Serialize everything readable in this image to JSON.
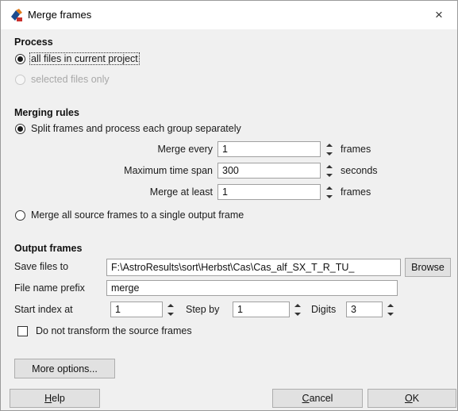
{
  "window": {
    "title": "Merge frames",
    "close_symbol": "×"
  },
  "process": {
    "section_title": "Process",
    "option_all": "all files in current project",
    "option_selected": "selected files only"
  },
  "merging_rules": {
    "section_title": "Merging rules",
    "option_split": "Split frames and process each group separately",
    "merge_every": {
      "label": "Merge every",
      "value": "1",
      "unit": "frames"
    },
    "max_time_span": {
      "label": "Maximum time span",
      "value": "300",
      "unit": "seconds"
    },
    "merge_at_least": {
      "label": "Merge at least",
      "value": "1",
      "unit": "frames"
    },
    "option_all_single": "Merge all source frames to a single output frame"
  },
  "output_frames": {
    "section_title": "Output frames",
    "save_files_label": "Save files to",
    "save_files_value": "F:\\AstroResults\\sort\\Herbst\\Cas\\Cas_alf_SX_T_R_TU_",
    "browse_label": "Browse",
    "prefix_label": "File name prefix",
    "prefix_value": "merge",
    "start_index_label": "Start index at",
    "start_index_value": "1",
    "step_label": "Step by",
    "step_value": "1",
    "digits_label": "Digits",
    "digits_value": "3",
    "no_transform_label": "Do not transform the source frames"
  },
  "buttons": {
    "more_options": "More options...",
    "help_mnemonic": "H",
    "help_rest": "elp",
    "cancel_mnemonic": "C",
    "cancel_rest": "ancel",
    "ok_mnemonic": "O",
    "ok_rest": "K"
  },
  "colors": {
    "window_bg": "#f0f0f0",
    "titlebar_bg": "#ffffff",
    "button_bg": "#e1e1e1",
    "disabled_text": "#a8a8a8"
  }
}
